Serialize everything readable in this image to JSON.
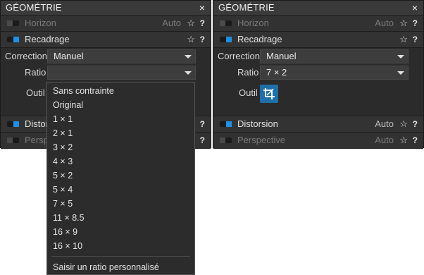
{
  "panel_title": "GÉOMÉTRIE",
  "close_glyph": "×",
  "star_glyph": "☆",
  "help_glyph": "?",
  "accent_color": "#1e90e8",
  "left": {
    "rows": {
      "horizon": {
        "label": "Horizon",
        "auto": "Auto",
        "enabled": false
      },
      "recadrage": {
        "label": "Recadrage",
        "enabled": true
      },
      "distorsion": {
        "label": "Distorsion",
        "enabled": true
      },
      "perspective": {
        "label": "Perspective",
        "enabled": false
      }
    },
    "correction_label": "Correction",
    "correction_value": "Manuel",
    "ratio_label": "Ratio",
    "ratio_value": "",
    "outil_label": "Outil",
    "ratio_options": [
      "Sans contrainte",
      "Original",
      "1 × 1",
      "2 × 1",
      "3 × 2",
      "4 × 3",
      "5 × 2",
      "5 × 4",
      "7 × 5",
      "11 × 8.5",
      "16 × 9",
      "16 × 10"
    ],
    "custom_ratio_option": "Saisir un ratio personnalisé"
  },
  "right": {
    "rows": {
      "horizon": {
        "label": "Horizon",
        "auto": "Auto",
        "enabled": false
      },
      "recadrage": {
        "label": "Recadrage",
        "enabled": true
      },
      "distorsion": {
        "label": "Distorsion",
        "auto": "Auto",
        "enabled": true
      },
      "perspective": {
        "label": "Perspective",
        "auto": "Auto",
        "enabled": false
      }
    },
    "correction_label": "Correction",
    "correction_value": "Manuel",
    "ratio_label": "Ratio",
    "ratio_value": "7 × 2",
    "outil_label": "Outil",
    "tool_icon": "crop-icon"
  }
}
